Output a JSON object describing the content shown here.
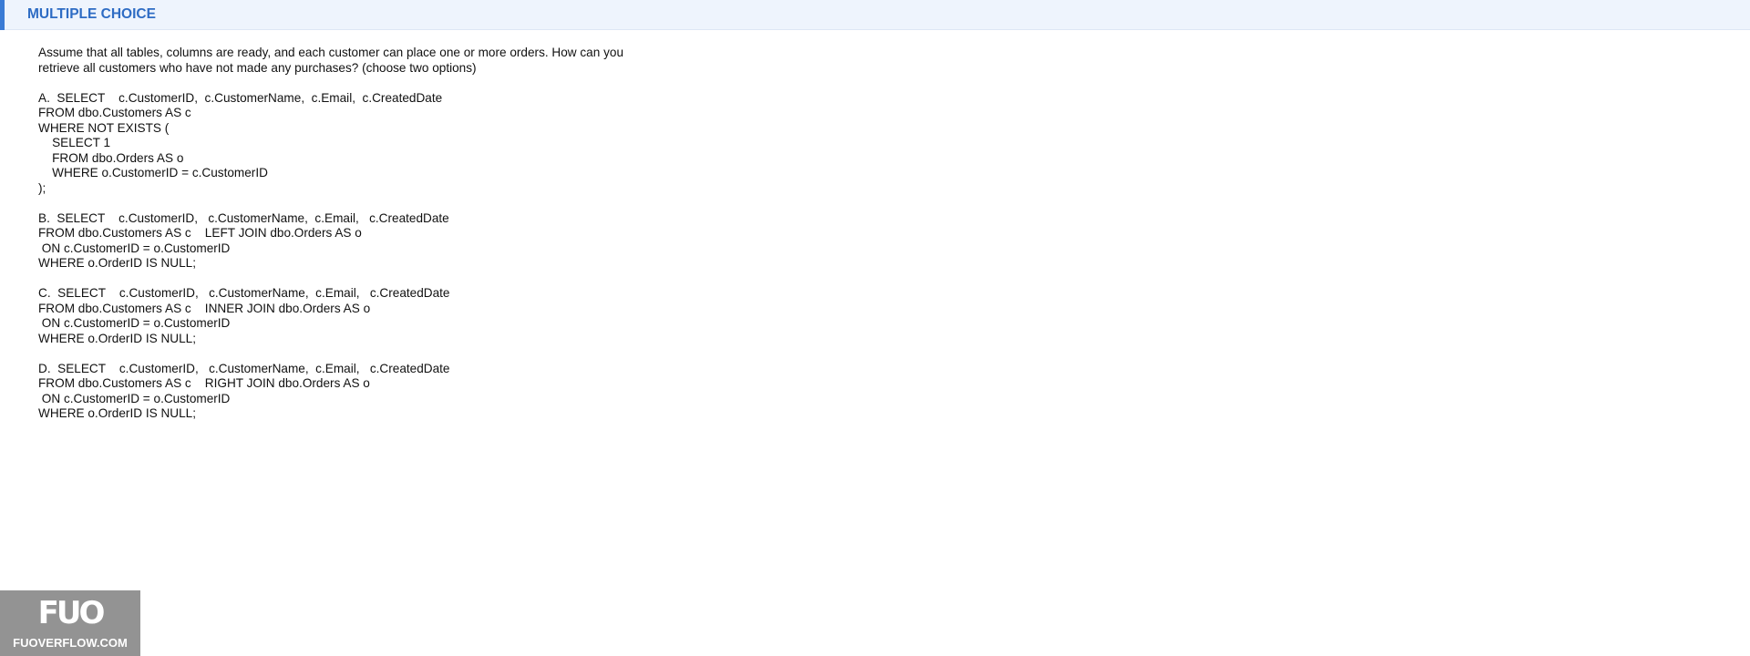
{
  "header": {
    "title": "MULTIPLE CHOICE",
    "accent_color": "#3a7bd5",
    "background_color": "#eef4fd",
    "title_color": "#2e6cc4"
  },
  "question": {
    "lines": [
      "Assume that all tables, columns are ready, and each customer can place one or more orders. How can you",
      "retrieve all customers who have not made any purchases? (choose two options)"
    ]
  },
  "options": [
    {
      "letter": "A",
      "lines": [
        "A.  SELECT    c.CustomerID,  c.CustomerName,  c.Email,  c.CreatedDate",
        "FROM dbo.Customers AS c",
        "WHERE NOT EXISTS (",
        "    SELECT 1",
        "    FROM dbo.Orders AS o",
        "    WHERE o.CustomerID = c.CustomerID",
        ");"
      ]
    },
    {
      "letter": "B",
      "lines": [
        "B.  SELECT    c.CustomerID,   c.CustomerName,  c.Email,   c.CreatedDate",
        "FROM dbo.Customers AS c    LEFT JOIN dbo.Orders AS o",
        " ON c.CustomerID = o.CustomerID",
        "WHERE o.OrderID IS NULL;"
      ]
    },
    {
      "letter": "C",
      "lines": [
        "C.  SELECT    c.CustomerID,   c.CustomerName,  c.Email,   c.CreatedDate",
        "FROM dbo.Customers AS c    INNER JOIN dbo.Orders AS o",
        " ON c.CustomerID = o.CustomerID",
        "WHERE o.OrderID IS NULL;"
      ]
    },
    {
      "letter": "D",
      "lines": [
        "D.  SELECT    c.CustomerID,   c.CustomerName,  c.Email,   c.CreatedDate",
        "FROM dbo.Customers AS c    RIGHT JOIN dbo.Orders AS o",
        " ON c.CustomerID = o.CustomerID",
        "WHERE o.OrderID IS NULL;"
      ]
    }
  ],
  "watermark": {
    "logo": "FUO",
    "text": "FUOVERFLOW.COM"
  }
}
